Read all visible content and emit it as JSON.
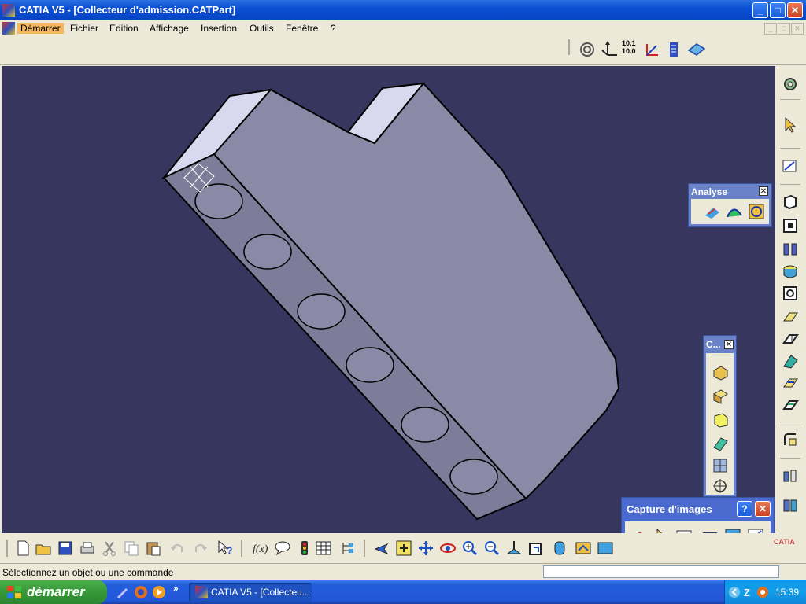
{
  "window": {
    "title": "CATIA V5 - [Collecteur d'admission.CATPart]",
    "buttons": {
      "minimize": "_",
      "maximize": "□",
      "close": "✕"
    }
  },
  "menu": {
    "items": [
      "Démarrer",
      "Fichier",
      "Edition",
      "Affichage",
      "Insertion",
      "Outils",
      "Fenêtre",
      "?"
    ]
  },
  "top_toolbar": {
    "icons": [
      "spiral-icon",
      "axis-system-icon",
      "units-icon",
      "compass-icon",
      "list-icon",
      "sketch-plane-icon"
    ],
    "units_label_top": "10.1",
    "units_label_bottom": "10.0"
  },
  "panels": {
    "analyse": {
      "title": "Analyse",
      "close": "✕",
      "icons": [
        "draft-analysis-icon",
        "curvature-analysis-icon",
        "mapping-icon"
      ]
    },
    "c": {
      "title": "C...",
      "close": "✕"
    },
    "capture": {
      "title": "Capture d'images",
      "help": "?",
      "close": "✕"
    }
  },
  "status": {
    "message": "Sélectionnez un objet ou une commande",
    "command_value": ""
  },
  "taskbar": {
    "start": "démarrer",
    "chevron": "»",
    "task": "CATIA V5 - [Collecteu...",
    "clock": "15:39",
    "brand": "CATIA"
  },
  "colors": {
    "viewport": "#36365f",
    "part_face": "#8a8aa6",
    "part_top": "#d8d8ee",
    "chrome": "#ece9d8"
  }
}
